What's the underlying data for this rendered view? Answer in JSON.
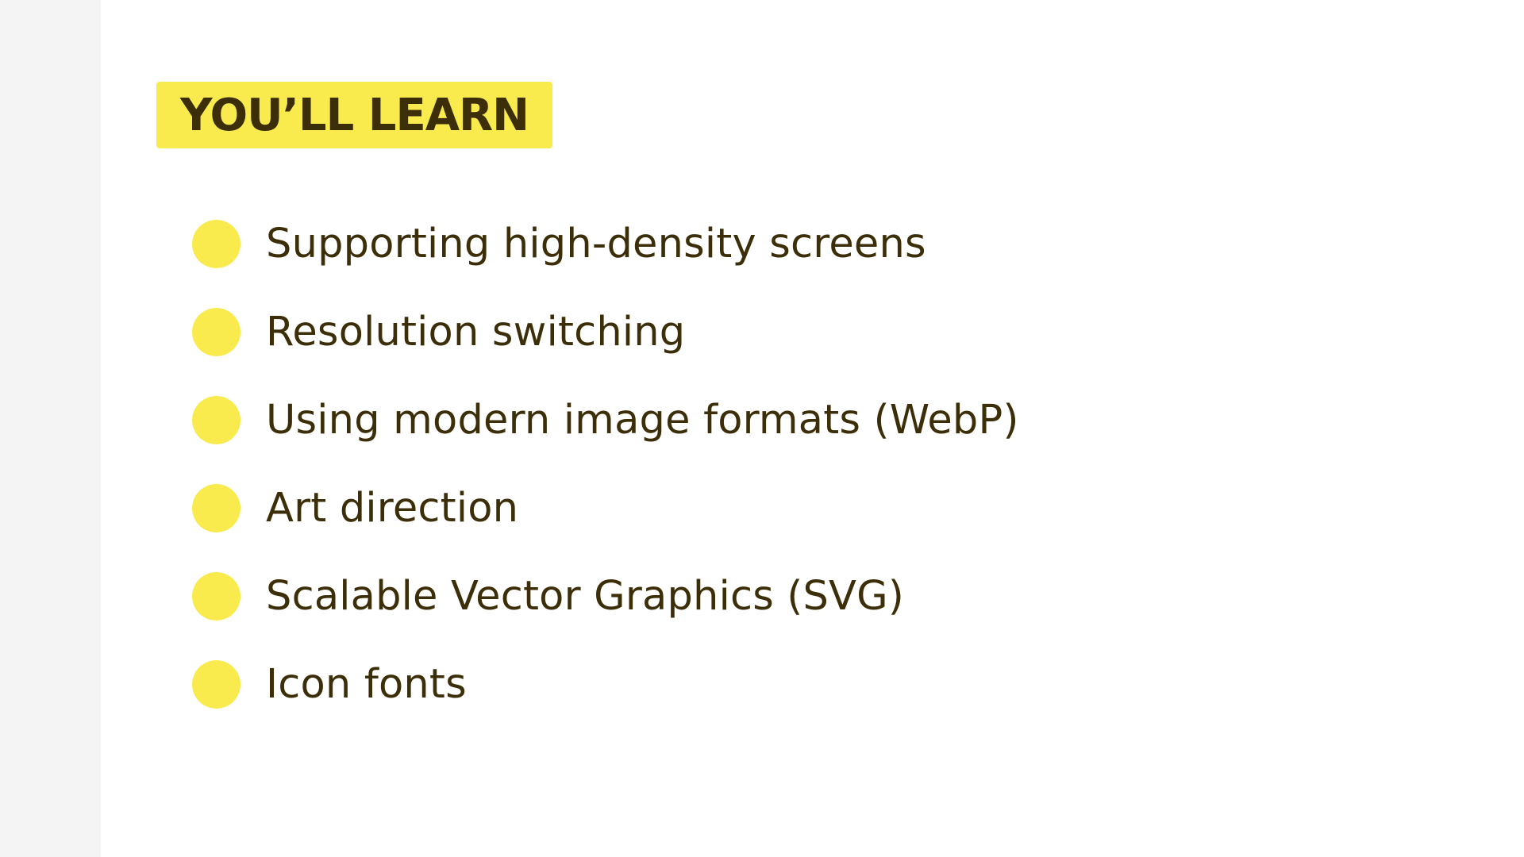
{
  "heading": "YOU’LL LEARN",
  "items": [
    {
      "text": "Supporting high-density screens"
    },
    {
      "text": "Resolution switching"
    },
    {
      "text": "Using modern image formats (WebP)"
    },
    {
      "text": "Art direction"
    },
    {
      "text": "Scalable Vector Graphics (SVG)"
    },
    {
      "text": "Icon fonts"
    }
  ],
  "colors": {
    "accent": "#f9eb4d",
    "text": "#3b2e08",
    "sidebar": "#f4f4f4",
    "background": "#ffffff"
  }
}
